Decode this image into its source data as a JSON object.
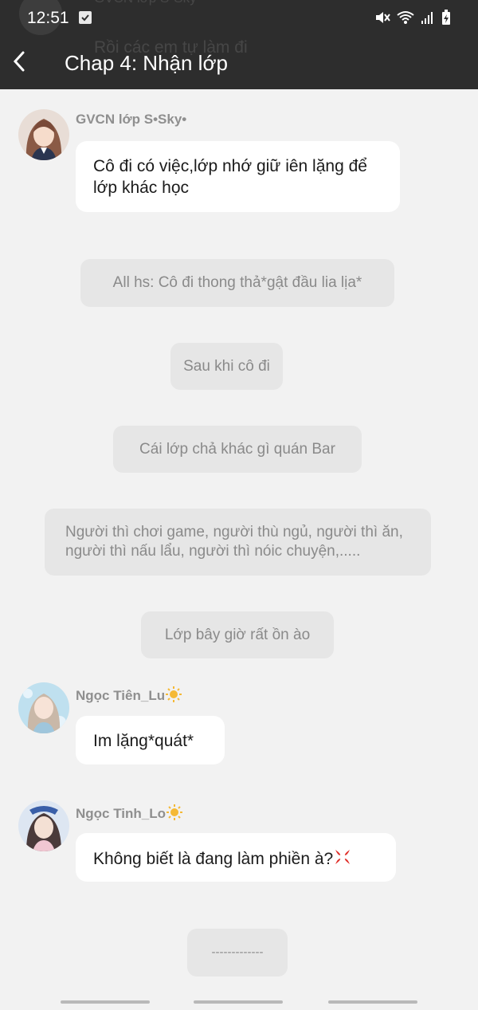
{
  "status_bar": {
    "time": "12:51"
  },
  "header": {
    "title": "Chap 4: Nhận lớp",
    "ghost_name": "GVCN lớp S•Sky•",
    "ghost_message": "Rồi các em tự làm đi"
  },
  "messages": [
    {
      "sender": "GVCN lớp S•Sky•",
      "text": "Cô đi có việc,lớp nhớ giữ iên lặng để lớp khác học"
    },
    {
      "narration": "All hs: Cô đi thong thả*gật đầu lia lịa*"
    },
    {
      "narration": "Sau khi cô đi"
    },
    {
      "narration": "Cái lớp chả khác gì quán Bar"
    },
    {
      "narration": "Người  thì chơi game, người thù ngủ, người thì ăn, người thì nấu lẩu, người thì nóic chuyện,....."
    },
    {
      "narration": "Lớp bây giờ rất ồn ào"
    },
    {
      "sender": "Ngọc Tiên_Lu",
      "sender_icon": "sun-icon",
      "text": "Im lặng*quát*"
    },
    {
      "sender": "Ngọc Tinh_Lo",
      "sender_icon": "sun-icon",
      "text": "Không biết là đang làm phiền à?",
      "text_icon": "anger-icon"
    },
    {
      "narration": "-------------"
    }
  ],
  "colors": {
    "topbar": "#2d2d2d",
    "background": "#f2f2f2",
    "bubble": "#ffffff",
    "narration": "#e6e6e6"
  }
}
